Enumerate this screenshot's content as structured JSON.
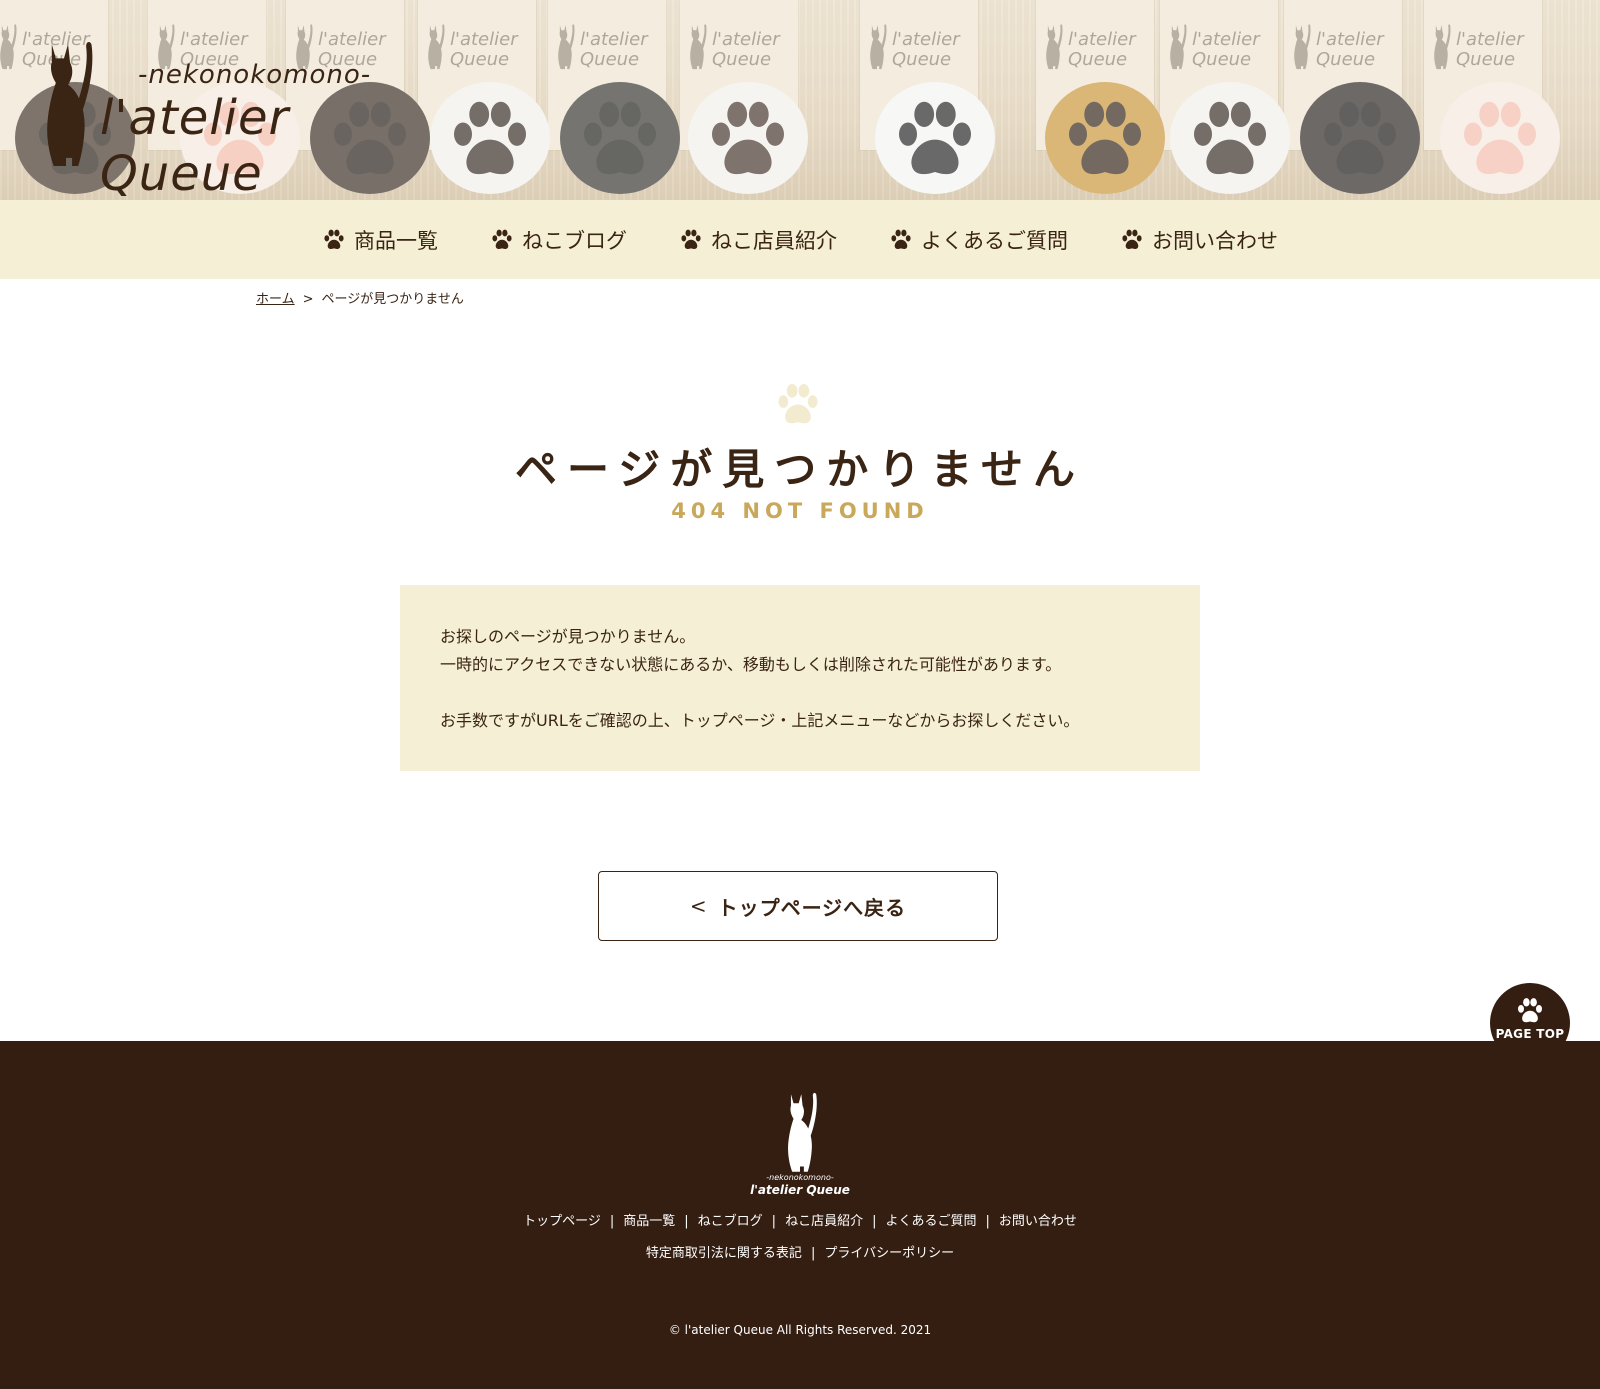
{
  "brand": {
    "sub": "-nekonokomono-",
    "name": "l'atelier Queue",
    "card_line1": "l'atelier",
    "card_line2": "Queue"
  },
  "nav": {
    "items": [
      {
        "label": "商品一覧"
      },
      {
        "label": "ねこブログ"
      },
      {
        "label": "ねこ店員紹介"
      },
      {
        "label": "よくあるご質問"
      },
      {
        "label": "お問い合わせ"
      }
    ]
  },
  "breadcrumb": {
    "home": "ホーム",
    "separator": ">",
    "current": "ページが見つかりません"
  },
  "main": {
    "title": "ページが見つかりません",
    "subtitle": "404 NOT FOUND",
    "message_line1": "お探しのページが見つかりません。",
    "message_line2": "一時的にアクセスできない状態にあるか、移動もしくは削除された可能性があります。",
    "message_line3": "お手数ですがURLをご確認の上、トップページ・上記メニューなどからお探しください。",
    "back_button": "トップページへ戻る",
    "back_chevron": "<"
  },
  "footer": {
    "logo_sub": "-nekonokomono-",
    "logo_name": "l'atelier Queue",
    "links_row1": [
      {
        "label": "トップページ"
      },
      {
        "label": "商品一覧"
      },
      {
        "label": "ねこブログ"
      },
      {
        "label": "ねこ店員紹介"
      },
      {
        "label": "よくあるご質問"
      },
      {
        "label": "お問い合わせ"
      }
    ],
    "links_row2": [
      {
        "label": "特定商取引法に関する表記"
      },
      {
        "label": "プライバシーポリシー"
      }
    ],
    "separator": "|",
    "copyright": "© l'atelier Queue All Rights Reserved. 2021"
  },
  "page_top": {
    "label": "PAGE TOP"
  },
  "colors": {
    "brown": "#3a2414",
    "footer_bg": "#341e12",
    "cream": "#f5efd6",
    "gold": "#c9a85c"
  },
  "icons": {
    "nav": "paw-icon",
    "title": "paw-icon",
    "page_top": "paw-icon",
    "logo": "cat-silhouette-icon"
  }
}
